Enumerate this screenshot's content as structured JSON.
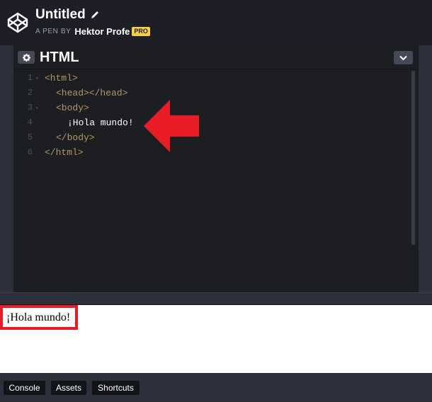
{
  "header": {
    "title": "Untitled",
    "byline_label": "A PEN BY",
    "author": "Hektor Profe",
    "badge": "PRO"
  },
  "editor": {
    "title": "HTML",
    "lines": [
      {
        "num": "1",
        "fold": "▾",
        "code": "<html>",
        "kind": "tag",
        "indent": 0
      },
      {
        "num": "2",
        "fold": "",
        "code": "<head></head>",
        "kind": "tag",
        "indent": 1
      },
      {
        "num": "3",
        "fold": "▾",
        "code": "<body>",
        "kind": "tag",
        "indent": 1
      },
      {
        "num": "4",
        "fold": "",
        "code": "¡Hola mundo!",
        "kind": "text",
        "indent": 2
      },
      {
        "num": "5",
        "fold": "",
        "code": "</body>",
        "kind": "tag",
        "indent": 1
      },
      {
        "num": "6",
        "fold": "",
        "code": "</html>",
        "kind": "tag",
        "indent": 0
      }
    ]
  },
  "preview": {
    "text": "¡Hola mundo!"
  },
  "footer": {
    "console_label": "Console",
    "assets_label": "Assets",
    "shortcuts_label": "Shortcuts"
  },
  "colors": {
    "background": "#1e1f26",
    "editor_bg": "#1d1e22",
    "tag": "#b09668",
    "highlight_red": "#e81c24",
    "pro_badge": "#f7d046"
  },
  "icons": [
    "codepen-logo-icon",
    "pencil-icon",
    "gear-icon",
    "chevron-down-icon",
    "red-arrow-icon"
  ]
}
